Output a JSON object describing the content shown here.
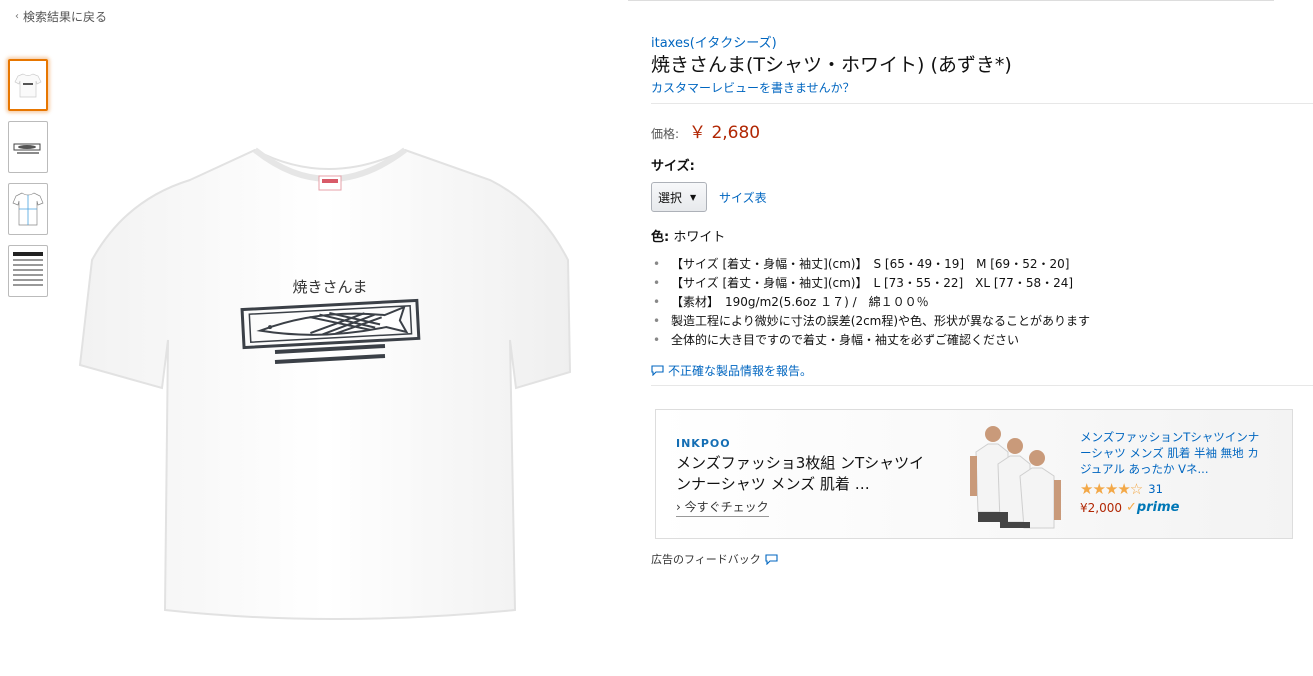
{
  "nav": {
    "back_label": "検索結果に戻る"
  },
  "gallery": {
    "thumb_count": 4,
    "selected_index": 0,
    "tshirt_print_text": "焼きさんま"
  },
  "product": {
    "brand": "itaxes(イタクシーズ)",
    "title": "焼きさんま(Tシャツ・ホワイト) (あずき*)",
    "review_link": "カスタマーレビューを書きませんか？",
    "price_label": "価格:",
    "price": "￥ 2,680",
    "size_label": "サイズ:",
    "size_select_value": "選択",
    "size_chart_link": "サイズ表",
    "color_label": "色:",
    "color_value": "ホワイト",
    "bullets": [
      "【サイズ [着丈・身幅・袖丈](cm)】　S [65・49・19]　M [69・52・20]",
      "【サイズ [着丈・身幅・袖丈](cm)】　L [73・55・22]　XL [77・58・24]",
      "【素材】　190g/m2(5.6oz １７) /　綿１００％",
      "製造工程により微妙に寸法の誤差(2cm程)や色、形状が異なることがあります",
      "全体的に大き目ですので着丈・身幅・袖丈を必ずご確認ください"
    ],
    "report_link": "不正確な製品情報を報告。"
  },
  "ad": {
    "brand": "INKPOO",
    "headline": "メンズファッショ3枚組 ンTシャツインナーシャツ メンズ 肌着 …",
    "cta": "今すぐチェック",
    "product_title": "メンズファッションTシャツインナーシャツ メンズ 肌着 半袖 無地 カジュアル あったか Vネ...",
    "stars": "★★★★☆",
    "rating_count": "31",
    "price": "¥2,000",
    "prime_label": "prime",
    "feedback": "広告のフィードバック"
  },
  "colors": {
    "link": "#0066c0",
    "price": "#b12704",
    "selected_thumb": "#e77600",
    "star": "#f3a847"
  }
}
